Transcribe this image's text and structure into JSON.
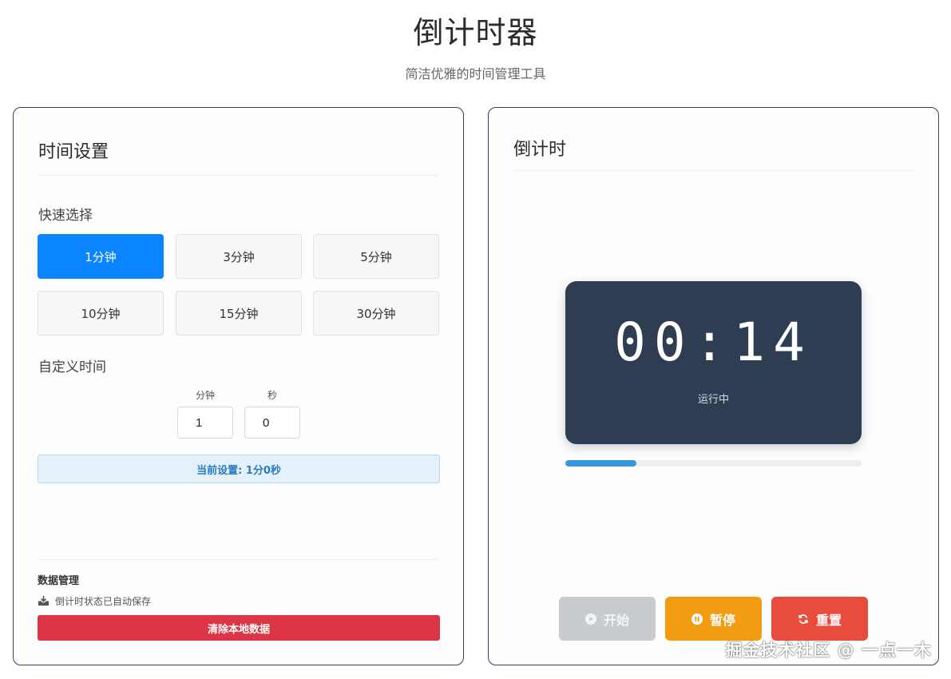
{
  "header": {
    "title": "倒计时器",
    "subtitle": "简洁优雅的时间管理工具"
  },
  "settings": {
    "title": "时间设置",
    "quick_label": "快速选择",
    "presets": [
      "1分钟",
      "3分钟",
      "5分钟",
      "10分钟",
      "15分钟",
      "30分钟"
    ],
    "active_preset": "1分钟",
    "custom_label": "自定义时间",
    "minutes_label": "分钟",
    "seconds_label": "秒",
    "minutes_value": "1",
    "seconds_value": "0",
    "current_setting": "当前设置: 1分0秒",
    "data_title": "数据管理",
    "save_note": "倒计时状态已自动保存",
    "clear_button": "清除本地数据"
  },
  "countdown": {
    "title": "倒计时",
    "display": "00:14",
    "status": "运行中",
    "progress_fraction": 0.24,
    "start_label": "开始",
    "pause_label": "暂停",
    "reset_label": "重置"
  },
  "watermark": "掘金技术社区 @ 一点一木",
  "colors": {
    "accent": "#0a84ff",
    "timer_bg": "#2e3d52",
    "progress": "#3498db",
    "pause": "#f39c12",
    "reset": "#e74c3c",
    "danger": "#dc3545",
    "disabled": "#c7ccd1"
  }
}
